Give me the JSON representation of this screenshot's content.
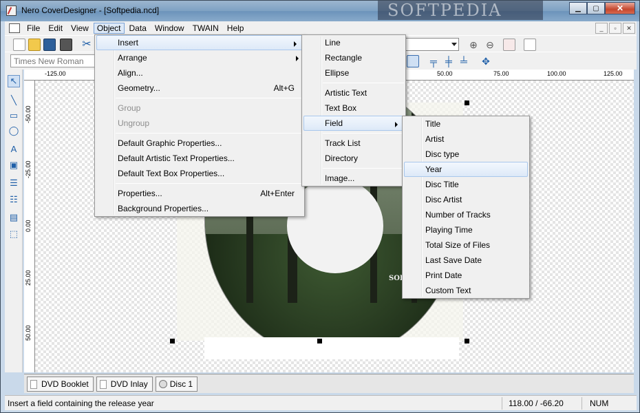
{
  "window": {
    "title": "Nero CoverDesigner - [Softpedia.ncd]",
    "watermark": "SOFTPEDIA"
  },
  "menubar": {
    "items": [
      "File",
      "Edit",
      "View",
      "Object",
      "Data",
      "Window",
      "TWAIN",
      "Help"
    ]
  },
  "toolbar": {
    "font_name": "Times New Roman"
  },
  "rulers": {
    "horizontal": [
      "-125.00",
      "50.00",
      "75.00",
      "100.00",
      "125.00"
    ],
    "vertical": [
      "-50.00",
      "-25.00",
      "0.00",
      "25.00",
      "50.00"
    ]
  },
  "canvas": {
    "overlay_text": "SOF"
  },
  "object_menu": {
    "items": [
      {
        "label": "Insert",
        "submenu": true
      },
      {
        "label": "Arrange",
        "submenu": true
      },
      {
        "label": "Align..."
      },
      {
        "label": "Geometry...",
        "shortcut": "Alt+G"
      },
      {
        "label": "Group",
        "disabled": true
      },
      {
        "label": "Ungroup",
        "disabled": true
      },
      {
        "label": "Default Graphic Properties..."
      },
      {
        "label": "Default Artistic Text Properties..."
      },
      {
        "label": "Default Text Box Properties..."
      },
      {
        "label": "Properties...",
        "shortcut": "Alt+Enter"
      },
      {
        "label": "Background Properties..."
      }
    ]
  },
  "insert_menu": {
    "items": [
      "Line",
      "Rectangle",
      "Ellipse",
      "Artistic Text",
      "Text Box",
      "Field",
      "Track List",
      "Directory",
      "Image..."
    ]
  },
  "field_menu": {
    "items": [
      "Title",
      "Artist",
      "Disc type",
      "Year",
      "Disc Title",
      "Disc Artist",
      "Number of Tracks",
      "Playing Time",
      "Total Size of Files",
      "Last Save Date",
      "Print Date",
      "Custom Text"
    ],
    "highlighted": "Year"
  },
  "tabs": [
    "DVD Booklet",
    "DVD Inlay",
    "Disc 1"
  ],
  "status": {
    "message": "Insert a field containing the release year",
    "coords": "118.00 / -66.20",
    "num": "NUM"
  }
}
